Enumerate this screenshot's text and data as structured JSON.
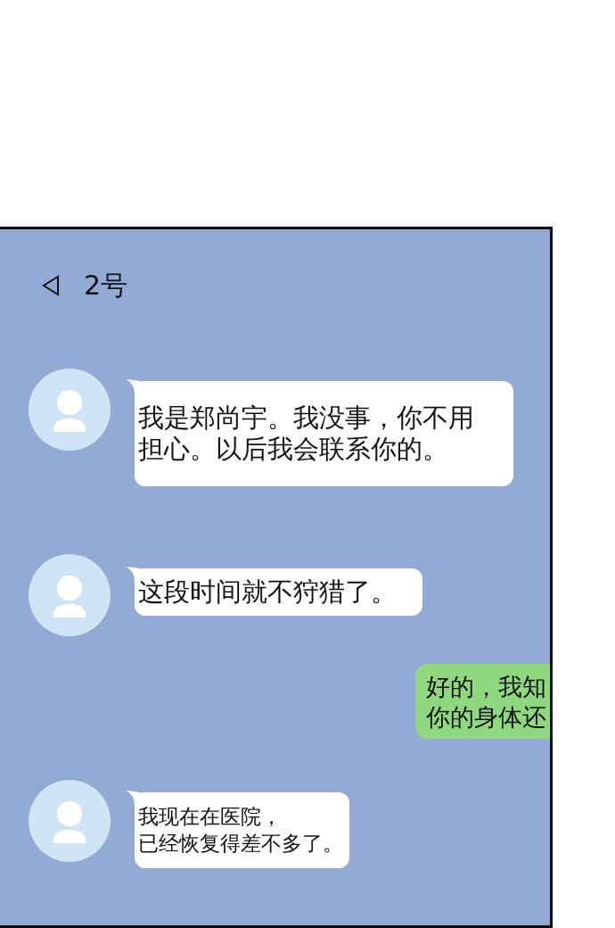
{
  "chat": {
    "title": "2号",
    "messages": [
      {
        "kind": "incoming",
        "lines": [
          "我是郑尚宇。我没事，你不用",
          "担心。以后我会联系你的。"
        ]
      },
      {
        "kind": "incoming",
        "lines": [
          "这段时间就不狩猎了。"
        ]
      },
      {
        "kind": "outgoing",
        "lines": [
          "好的，我知",
          "你的身体还"
        ]
      },
      {
        "kind": "incoming",
        "lines": [
          "我现在在医院，",
          "已经恢复得差不多了。"
        ]
      }
    ]
  }
}
